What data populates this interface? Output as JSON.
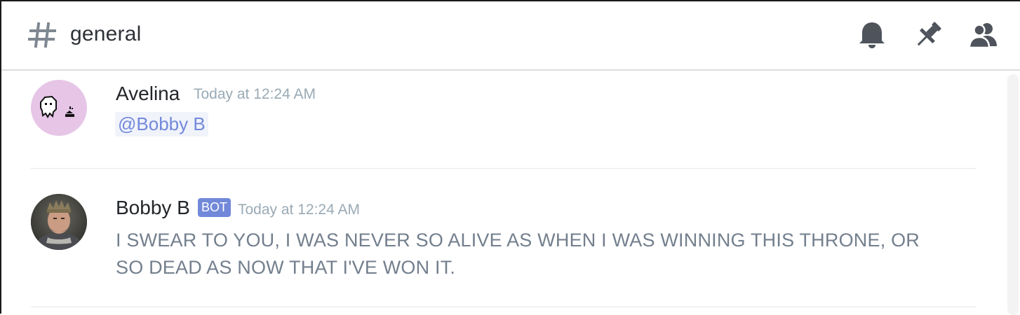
{
  "channel": {
    "name": "general"
  },
  "header_icons": [
    "bell-icon",
    "pin-icon",
    "members-icon"
  ],
  "messages": [
    {
      "author": "Avelina",
      "timestamp": "Today at 12:24 AM",
      "mention": "@Bobby B",
      "is_bot": false
    },
    {
      "author": "Bobby B",
      "bot_tag": "BOT",
      "timestamp": "Today at 12:24 AM",
      "text": "I SWEAR TO YOU, I WAS NEVER SO ALIVE AS WHEN I WAS WINNING THIS THRONE, OR SO DEAD AS NOW THAT I'VE WON IT.",
      "is_bot": true
    }
  ],
  "colors": {
    "accent": "#7289da",
    "mention_bg": "#f1f3fb",
    "timestamp": "#99aab5",
    "message_text": "#737f8d",
    "avatar_bg": "#e6c5e7"
  }
}
